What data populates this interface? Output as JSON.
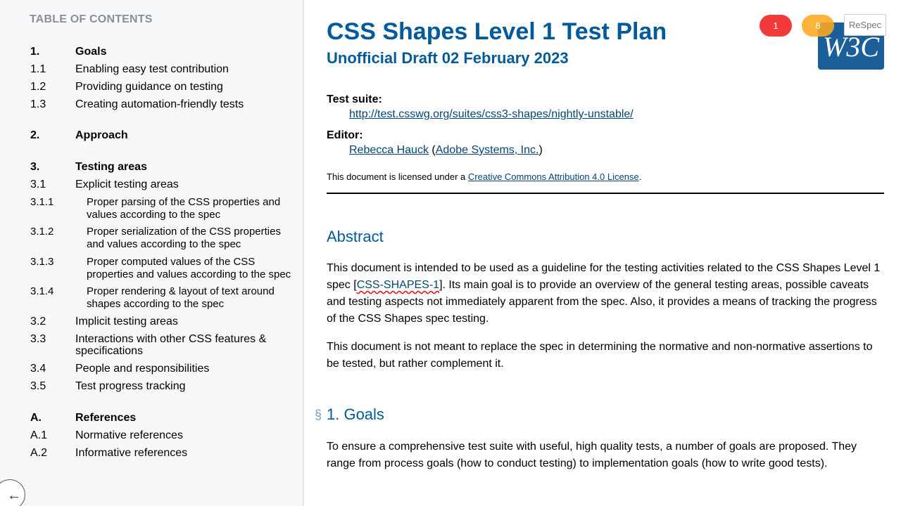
{
  "toc": {
    "heading": "TABLE OF CONTENTS",
    "entries": [
      {
        "num": "1.",
        "text": "Goals"
      },
      {
        "num": "1.1",
        "text": "Enabling easy test contribution"
      },
      {
        "num": "1.2",
        "text": "Providing guidance on testing"
      },
      {
        "num": "1.3",
        "text": "Creating automation-friendly tests"
      },
      {
        "num": "2.",
        "text": "Approach"
      },
      {
        "num": "3.",
        "text": "Testing areas"
      },
      {
        "num": "3.1",
        "text": "Explicit testing areas"
      },
      {
        "num": "3.1.1",
        "text_line1": "Proper parsing of the CSS properties and",
        "text_line2": "values according to the spec"
      },
      {
        "num": "3.1.2",
        "text_line1": "Proper serialization of the CSS properties",
        "text_line2": "and values according to the spec"
      },
      {
        "num": "3.1.3",
        "text_line1": "Proper computed values of the CSS",
        "text_line2": "properties and values according to the spec"
      },
      {
        "num": "3.1.4",
        "text_line1": "Proper rendering & layout of text around",
        "text_line2": "shapes according to the spec"
      },
      {
        "num": "3.2",
        "text": "Implicit testing areas"
      },
      {
        "num": "3.3",
        "text_line1": "Interactions with other CSS features &",
        "text_line2": "specifications"
      },
      {
        "num": "3.4",
        "text": "People and responsibilities"
      },
      {
        "num": "3.5",
        "text": "Test progress tracking"
      },
      {
        "num": "A.",
        "text": "References"
      },
      {
        "num": "A.1",
        "text": "Normative references"
      },
      {
        "num": "A.2",
        "text": "Informative references"
      }
    ],
    "back_button_glyph": "←"
  },
  "header": {
    "title": "CSS Shapes Level 1 Test Plan",
    "subtitle": "Unofficial Draft 02 February 2023",
    "logo_text": "W3C",
    "respec_errors": "1",
    "respec_warnings": "8",
    "respec_label": "ReSpec",
    "test_suite_label": "Test suite:",
    "test_suite_url": "http://test.csswg.org/suites/css3-shapes/nightly-unstable/",
    "editor_label": "Editor:",
    "editor_name": "Rebecca Hauck",
    "editor_paren_open": " (",
    "editor_org": "Adobe Systems, Inc.",
    "editor_paren_close": ")",
    "license_prefix": "This document is licensed under a ",
    "license_link": "Creative Commons Attribution 4.0 License",
    "license_suffix": "."
  },
  "abstract": {
    "heading": "Abstract",
    "p1_before": "This document is intended to be used as a guideline for the testing activities related to the CSS Shapes Level 1 spec [",
    "p1_ref": "CSS-SHAPES-1",
    "p1_after": "]. Its main goal is to provide an overview of the general testing areas, possible caveats and testing aspects not immediately apparent from the spec. Also, it provides a means of tracking the progress of the CSS Shapes spec testing.",
    "p2": "This document is not meant to replace the spec in determining the normative and non-normative assertions to be tested, but rather complement it."
  },
  "goals": {
    "section_mark": "§",
    "heading": "1. Goals",
    "p1": "To ensure a comprehensive test suite with useful, high quality tests, a number of goals are proposed. They range from process goals (how to conduct testing) to implementation goals (how to write good tests)."
  },
  "colors": {
    "heading_blue": "#005a9c",
    "link_blue": "#034575",
    "error_red": "#f23a3a",
    "warning_orange": "#ffaa1e",
    "sidebar_bg": "#f7f8f9"
  }
}
